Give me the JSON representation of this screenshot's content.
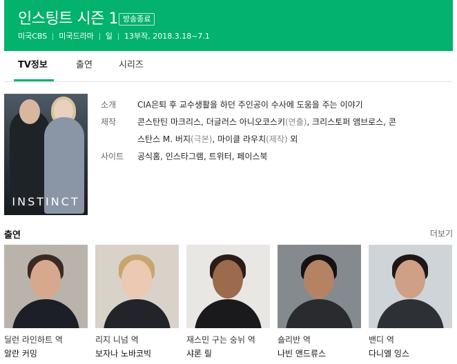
{
  "header": {
    "title": "인스팅트 시즌 1",
    "status": "방송종료",
    "meta": [
      "미국CBS",
      "미국드라마",
      "일",
      "13부작, 2018.3.18~7.1"
    ],
    "bg_color": "#03b26c"
  },
  "tabs": [
    {
      "label": "TV정보",
      "active": true
    },
    {
      "label": "출연",
      "active": false
    },
    {
      "label": "시리즈",
      "active": false
    }
  ],
  "poster": {
    "logo_text": "INSTINCT"
  },
  "info": {
    "intro_label": "소개",
    "intro_value": "CIA은퇴 후 교수생활을 하던 주인공이 수사에 도움을 주는 이야기",
    "production_label": "제작",
    "production_line1_a": "콘스탄틴 마크리스, 더글러스 아니오코스키",
    "production_line1_b": "(연출)",
    "production_line1_c": ", 크리스토퍼 앰브로스, 콘",
    "production_line2_a": "스탄스 M. 버지",
    "production_line2_b": "(극본)",
    "production_line2_c": ", 마이클 라우치",
    "production_line2_d": "(제작)",
    "production_line2_e": " 외",
    "site_label": "사이트",
    "sites": [
      "공식홈",
      "인스타그램",
      "트위터",
      "페이스북"
    ],
    "site_sep": ", "
  },
  "cast": {
    "title": "출연",
    "more": "더보기",
    "members": [
      {
        "role": "딜런 라인하트 역",
        "actor": "알란 커밍",
        "bg": "#b9b3ac",
        "skin": "#d7a88e",
        "hair": "#3a2a22",
        "suit": "#1c1f26"
      },
      {
        "role": "리지 니넘 역",
        "actor": "보자나 노바코빅",
        "bg": "#d8d2c8",
        "skin": "#ecc9b2",
        "hair": "#c9a56e",
        "suit": "#23242a"
      },
      {
        "role": "재스민 구는 숭뉘 역",
        "actor": "샤론 릴",
        "bg": "#e9e7e4",
        "skin": "#9c6a4d",
        "hair": "#2a1d17",
        "suit": "#1a1a1d"
      },
      {
        "role": "숄리반 역",
        "actor": "나빈 앤드류스",
        "bg": "#858a8f",
        "skin": "#b58364",
        "hair": "#141212",
        "suit": "#2a2b2e"
      },
      {
        "role": "밴디 역",
        "actor": "다니엘 잉스",
        "bg": "#cfd4d8",
        "skin": "#cf9f86",
        "hair": "#1e1814",
        "suit": "#2d3136"
      }
    ]
  }
}
